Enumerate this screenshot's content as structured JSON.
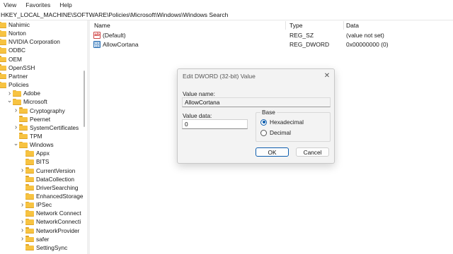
{
  "menu": {
    "items": [
      "View",
      "Favorites",
      "Help"
    ]
  },
  "address": {
    "path": "HKEY_LOCAL_MACHINE\\SOFTWARE\\Policies\\Microsoft\\Windows\\Windows Search"
  },
  "tree": {
    "items": [
      {
        "label": "Nahimic",
        "expandable": false
      },
      {
        "label": "Norton",
        "expandable": false
      },
      {
        "label": "NVIDIA Corporation",
        "expandable": false
      },
      {
        "label": "ODBC",
        "expandable": false
      },
      {
        "label": "OEM",
        "expandable": false
      },
      {
        "label": "OpenSSH",
        "expandable": false
      },
      {
        "label": "Partner",
        "expandable": false
      },
      {
        "label": "Policies",
        "expandable": true,
        "expanded": true
      },
      {
        "label": "Adobe",
        "expandable": true
      },
      {
        "label": "Microsoft",
        "expandable": true,
        "expanded": true
      },
      {
        "label": "Cryptography",
        "expandable": true
      },
      {
        "label": "Peernet",
        "expandable": false
      },
      {
        "label": "SystemCertificates",
        "expandable": true
      },
      {
        "label": "TPM",
        "expandable": false
      },
      {
        "label": "Windows",
        "expandable": true,
        "expanded": true
      },
      {
        "label": "Appx",
        "expandable": false
      },
      {
        "label": "BITS",
        "expandable": false
      },
      {
        "label": "CurrentVersion",
        "expandable": true
      },
      {
        "label": "DataCollection",
        "expandable": false
      },
      {
        "label": "DriverSearching",
        "expandable": false
      },
      {
        "label": "EnhancedStorage",
        "expandable": false
      },
      {
        "label": "IPSec",
        "expandable": true
      },
      {
        "label": "Network Connect",
        "expandable": false
      },
      {
        "label": "NetworkConnecti",
        "expandable": true
      },
      {
        "label": "NetworkProvider",
        "expandable": true
      },
      {
        "label": "safer",
        "expandable": true
      },
      {
        "label": "SettingSync",
        "expandable": false
      }
    ]
  },
  "columns": {
    "name": "Name",
    "type": "Type",
    "data": "Data"
  },
  "values": [
    {
      "name": "(Default)",
      "type": "REG_SZ",
      "data": "(value not set)",
      "icon": "string-value-icon"
    },
    {
      "name": "AllowCortana",
      "type": "REG_DWORD",
      "data": "0x00000000 (0)",
      "icon": "dword-value-icon"
    }
  ],
  "dialog": {
    "title": "Edit DWORD (32-bit) Value",
    "value_name_label": "Value name:",
    "value_name": "AllowCortana",
    "value_data_label": "Value data:",
    "value_data": "0",
    "base_label": "Base",
    "hex_label": "Hexadecimal",
    "dec_label": "Decimal",
    "selected_base": "Hexadecimal",
    "ok_label": "OK",
    "cancel_label": "Cancel"
  },
  "colors": {
    "folder": "#f7c342",
    "accent": "#0b5cad"
  }
}
